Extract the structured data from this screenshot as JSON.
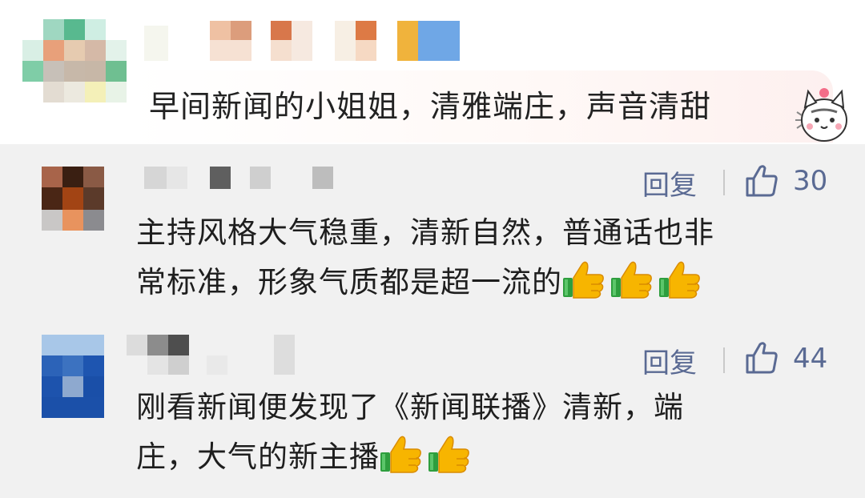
{
  "top_comment": {
    "text": "早间新闻的小姐姐，清雅端庄，声音清甜",
    "sticker": "cat-sticker"
  },
  "comments": [
    {
      "line1": "主持风格大气稳重，清新自然，普通话也非",
      "line2": "常标准，形象气质都是超一流的",
      "reply_label": "回复",
      "likes": "30",
      "emoji": [
        "thumbs-up-icon",
        "thumbs-up-icon",
        "thumbs-up-icon"
      ]
    },
    {
      "line1": "刚看新闻便发现了《新闻联播》清新，端",
      "line2": "庄，大气的新主播",
      "reply_label": "回复",
      "likes": "44",
      "emoji": [
        "thumbs-up-icon",
        "thumbs-up-icon"
      ]
    }
  ],
  "colors": {
    "page_bg": "#f1f1f1",
    "top_bg": "#ffffff",
    "action_color": "#5a6a93",
    "text_color": "#1e1e1e"
  }
}
